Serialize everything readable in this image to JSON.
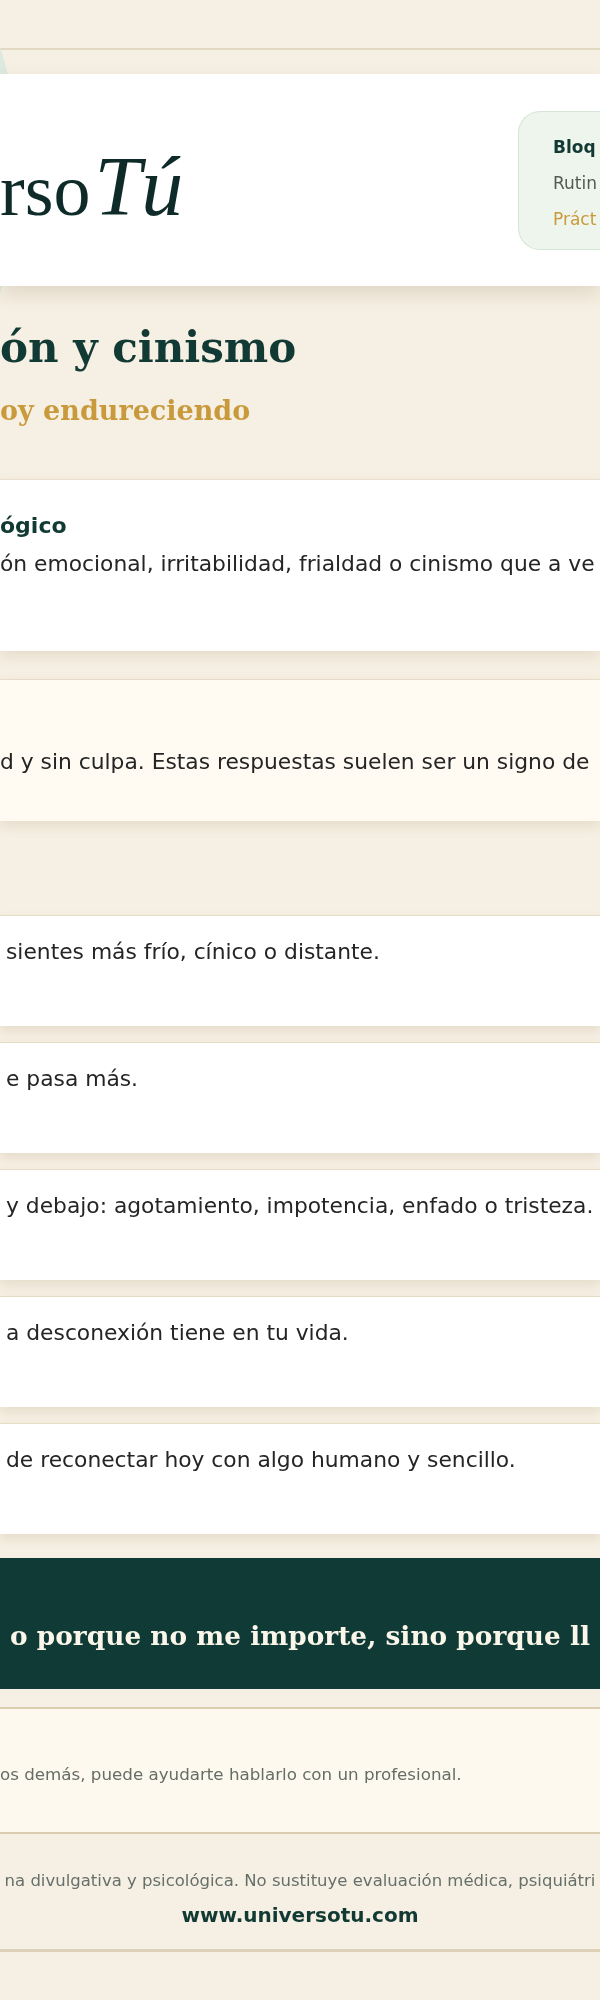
{
  "header": {
    "logo": {
      "text": "rso",
      "script": "Tú"
    },
    "badge": {
      "title": "Bloq",
      "line_2": "Rutin",
      "line_3": "Práct"
    }
  },
  "hero": {
    "title": "ón y cinismo",
    "subtitle": "oy endureciendo"
  },
  "intro_card": {
    "title": "ógico",
    "text": "ón emocional, irritabilidad, frialdad o cinismo que a ve"
  },
  "highlight_card": {
    "text": "d y sin culpa. Estas respuestas suelen ser un signo de"
  },
  "steps": [
    {
      "text": "sientes más frío, cínico o distante."
    },
    {
      "text": "e pasa más."
    },
    {
      "text": "y debajo: agotamiento, impotencia, enfado o tristeza."
    },
    {
      "text": "a desconexión tiene en tu vida."
    },
    {
      "text": "de reconectar hoy con algo humano y sencillo."
    }
  ],
  "quote": {
    "text": "o porque no me importe, sino porque ll"
  },
  "note": {
    "text": "os demás, puede ayudarte hablarlo con un profesional."
  },
  "footer": {
    "disclaimer": "na divulgativa y psicológica. No sustituye evaluación médica, psiquiátri",
    "url": "www.universotu.com"
  }
}
